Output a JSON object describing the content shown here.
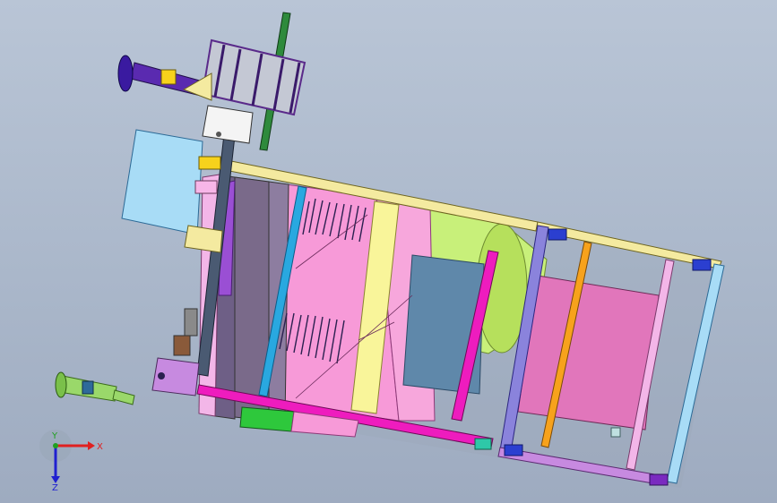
{
  "viewport": {
    "background_top": "#b9c5d6",
    "background_bottom": "#9eabc0"
  },
  "model": {
    "colors": {
      "frame_yellow": "#f4eaa0",
      "frame_blue": "#2b3fd0",
      "panel_pink": "#f79ad8",
      "panel_magenta": "#ee1cbe",
      "panel_violet": "#9a4fd4",
      "panel_lightblue": "#a8dcf6",
      "panel_yellow": "#f9f59a",
      "cylinder_green": "#c8f07a",
      "tank_steel": "#5f88aa",
      "tray_rose": "#e176bb",
      "bar_orange": "#f7a21c",
      "bar_cyan": "#29a8e0",
      "bar_green": "#2e8a3c",
      "box_green": "#2ec83c"
    }
  },
  "triad": {
    "x_label": "X",
    "y_label": "Y",
    "z_label": "Z"
  }
}
